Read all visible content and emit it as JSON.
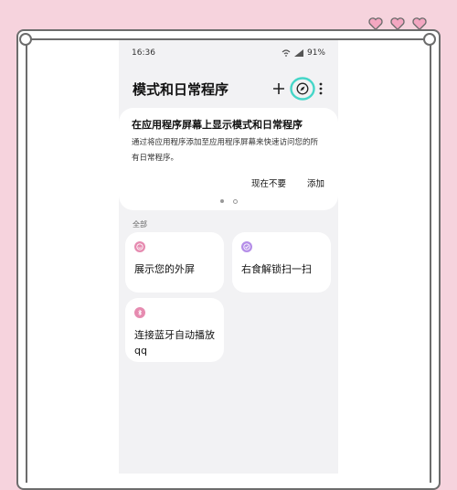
{
  "status_bar": {
    "time": "16:36",
    "battery": "91%"
  },
  "header": {
    "title": "模式和日常程序"
  },
  "promo": {
    "title": "在应用程序屏幕上显示模式和日常程序",
    "description": "通过将应用程序添加至应用程序屏幕来快速访问您的所有日常程序。",
    "dismiss_label": "现在不要",
    "add_label": "添加",
    "page_indicator": {
      "count": 2,
      "active": 1
    }
  },
  "section_label": "全部",
  "routines": [
    {
      "label": "展示您的外屏",
      "icon": "smile-icon",
      "icon_color": "#e68bb0"
    },
    {
      "label": "右食解锁扫一扫",
      "icon": "check-icon",
      "icon_color": "#b58ee8"
    },
    {
      "label": "连接蓝牙自动播放qq",
      "icon": "bluetooth-icon",
      "icon_color": "#e68bb0"
    }
  ],
  "colors": {
    "background": "#f6d3dd",
    "highlight_circle": "#45d6c8",
    "hearts": "#f3a7c1"
  }
}
